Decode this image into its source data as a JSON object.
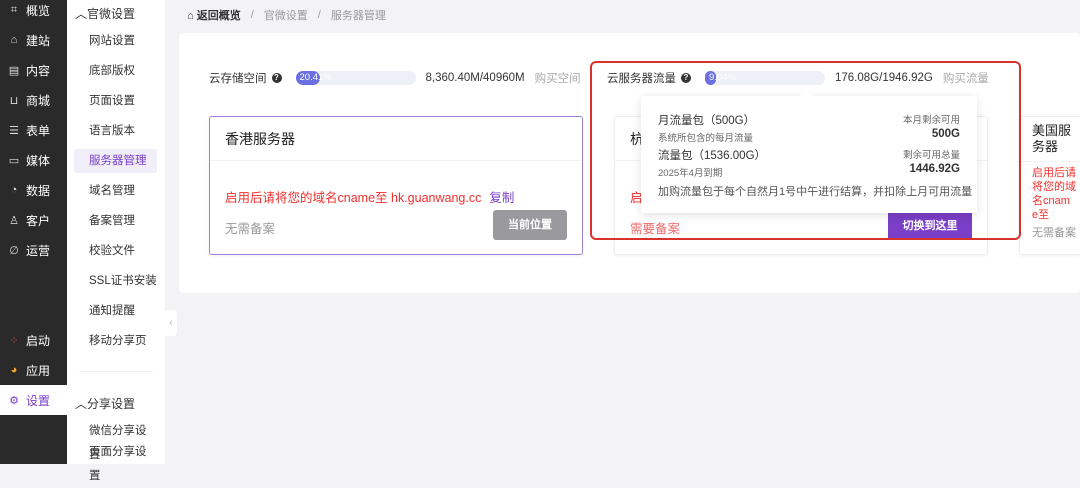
{
  "sidebar": {
    "items": [
      {
        "label": "概览",
        "icon": "chart-icon"
      },
      {
        "label": "建站",
        "icon": "home-icon"
      },
      {
        "label": "内容",
        "icon": "document-icon"
      },
      {
        "label": "商城",
        "icon": "cart-icon"
      },
      {
        "label": "表单",
        "icon": "form-icon"
      },
      {
        "label": "媒体",
        "icon": "video-icon"
      },
      {
        "label": "数据",
        "icon": "pie-icon"
      },
      {
        "label": "客户",
        "icon": "user-icon"
      },
      {
        "label": "运营",
        "icon": "paperclip-icon"
      },
      {
        "label": "启动",
        "icon": "dots-icon"
      },
      {
        "label": "应用",
        "icon": "apps-icon"
      },
      {
        "label": "设置",
        "icon": "gear-icon"
      }
    ]
  },
  "submenu": {
    "group1": "官微设置",
    "items1": [
      "网站设置",
      "底部版权",
      "页面设置",
      "语言版本",
      "服务器管理",
      "域名管理",
      "备案管理",
      "校验文件",
      "SSL证书安装",
      "通知提醒",
      "移动分享页"
    ],
    "group2": "分享设置",
    "items2": [
      "微信分享设置",
      "页面分享设置"
    ]
  },
  "breadcrumb": {
    "back": "返回概览",
    "items": [
      "官微设置",
      "服务器管理"
    ],
    "sep": "/"
  },
  "storage": {
    "label": "云存储空间",
    "percent_label": "20.41%",
    "percent": 20.41,
    "used": "8,360.40M/40960M",
    "buy": "购买空间"
  },
  "traffic": {
    "label": "云服务器流量",
    "percent_label": "9.04%",
    "percent": 9.04,
    "used": "176.08G/1946.92G",
    "buy": "购买流量"
  },
  "tooltip": {
    "monthly": {
      "title": "月流量包（500G）",
      "desc": "系统所包含的每月流量",
      "value_label": "本月剩余可用",
      "value": "500G"
    },
    "package": {
      "title": "流量包（1536.00G）",
      "desc": "2025年4月到期",
      "value_label": "剩余可用总量",
      "value": "1446.92G"
    },
    "note": "加购流量包于每个自然月1号中午进行结算，并扣除上月可用流量"
  },
  "cards": [
    {
      "title": "香港服务器",
      "cname": "启用后请将您的域名cname至 hk.guanwang.cc",
      "copy": "复制",
      "record": "无需备案",
      "button": "当前位置"
    },
    {
      "title": "杭",
      "cname": "启",
      "record": "需要备案",
      "button": "切换到这里"
    },
    {
      "title": "美国服务器",
      "cname": "启用后请将您的域名cname至",
      "record": "无需备案"
    }
  ]
}
